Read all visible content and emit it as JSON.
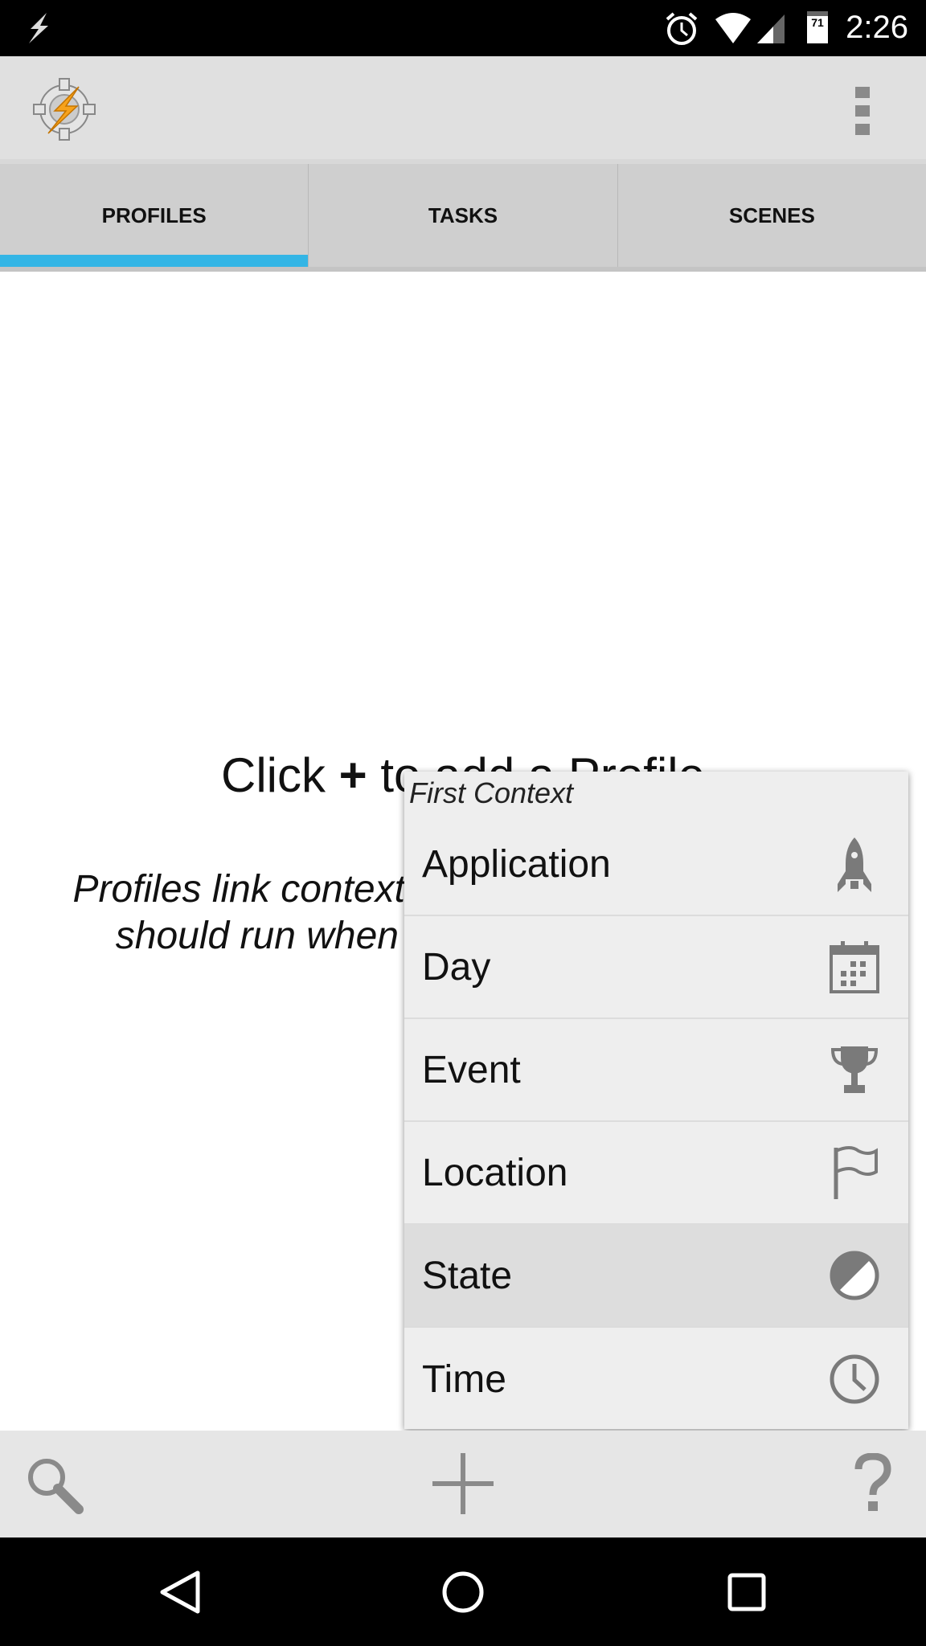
{
  "status_bar": {
    "time": "2:26",
    "battery": "71",
    "icons": [
      "flash-icon",
      "alarm-icon",
      "wifi-icon",
      "signal-icon",
      "battery-icon"
    ]
  },
  "action_bar": {
    "logo": "tasker-logo",
    "menu_icon": "overflow-menu-icon"
  },
  "tabs": [
    {
      "label": "PROFILES",
      "active": true
    },
    {
      "label": "TASKS",
      "active": false
    },
    {
      "label": "SCENES",
      "active": false
    }
  ],
  "accent_color": "#33b5e5",
  "content": {
    "hint_prefix": "Click ",
    "hint_plus": "+",
    "hint_suffix": " to add a Profile",
    "description_line1": "Profiles link contexts (conditions) to tasks that",
    "description_line2": "should run when those contexts are met."
  },
  "popup": {
    "title": "First Context",
    "items": [
      {
        "label": "Application",
        "icon": "rocket-icon"
      },
      {
        "label": "Day",
        "icon": "calendar-icon"
      },
      {
        "label": "Event",
        "icon": "trophy-icon"
      },
      {
        "label": "Location",
        "icon": "flag-icon"
      },
      {
        "label": "State",
        "icon": "half-circle-icon",
        "highlighted": true
      },
      {
        "label": "Time",
        "icon": "clock-icon"
      }
    ]
  },
  "bottom_bar": {
    "icons": [
      "search-icon",
      "add-icon",
      "help-icon"
    ]
  },
  "nav_bar": {
    "icons": [
      "back-icon",
      "home-icon",
      "recents-icon"
    ]
  }
}
